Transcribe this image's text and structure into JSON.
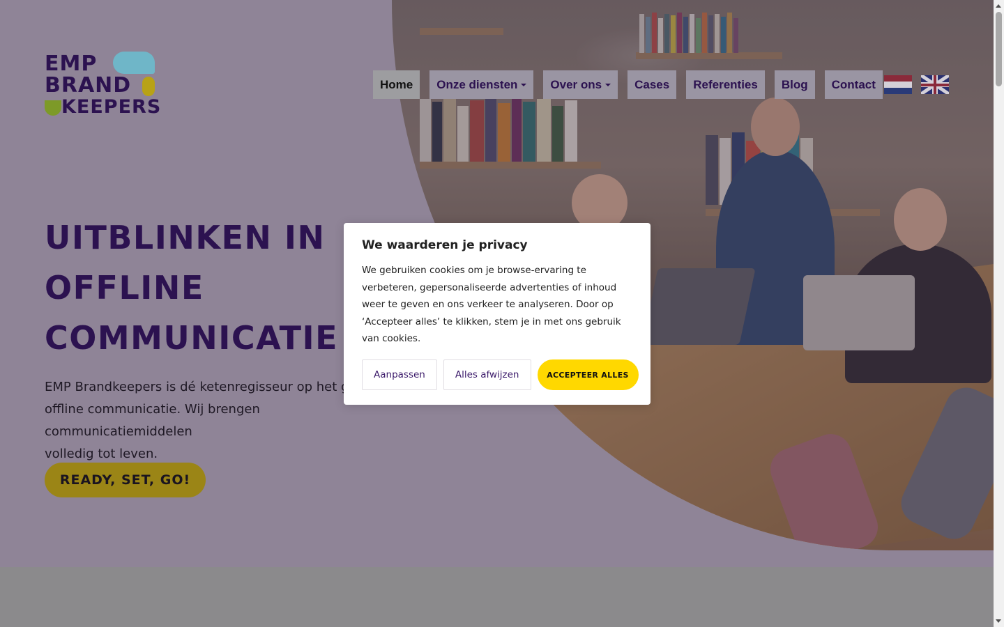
{
  "nav": {
    "items": [
      {
        "label": "Home",
        "active": true,
        "dropdown": false
      },
      {
        "label": "Onze diensten",
        "active": false,
        "dropdown": true
      },
      {
        "label": "Over ons",
        "active": false,
        "dropdown": true
      },
      {
        "label": "Cases",
        "active": false,
        "dropdown": false
      },
      {
        "label": "Referenties",
        "active": false,
        "dropdown": false
      },
      {
        "label": "Blog",
        "active": false,
        "dropdown": false
      },
      {
        "label": "Contact",
        "active": false,
        "dropdown": false
      }
    ],
    "languages": [
      "nl-flag-icon",
      "uk-flag-icon"
    ]
  },
  "logo": {
    "line1": "EMP",
    "line2": "BRAND",
    "line3": "KEEPERS"
  },
  "hero": {
    "headline_lines": [
      "UITBLINKEN IN",
      "OFFLINE",
      "COMMUNICATIE"
    ],
    "intro_lines": [
      "EMP Brandkeepers is dé ketenregisseur op het geb",
      "offline communicatie. Wij brengen communicatiemiddelen",
      "volledig tot leven."
    ],
    "cta_label": "READY, SET, GO!"
  },
  "cookie_modal": {
    "title": "We waarderen je privacy",
    "text": "We gebruiken cookies om je browse-ervaring te verbeteren, gepersonaliseerde advertenties of inhoud weer te geven en ons verkeer te analyseren. Door op ‘Accepteer alles’ te klikken, stem je in met ons gebruik van cookies.",
    "btn_customize": "Aanpassen",
    "btn_reject": "Alles afwijzen",
    "btn_accept": "ACCEPTEER ALLES"
  },
  "colors": {
    "brand_purple": "#2c1250",
    "accent_yellow": "#ffd800",
    "overlay_bg": "#8f8497"
  }
}
